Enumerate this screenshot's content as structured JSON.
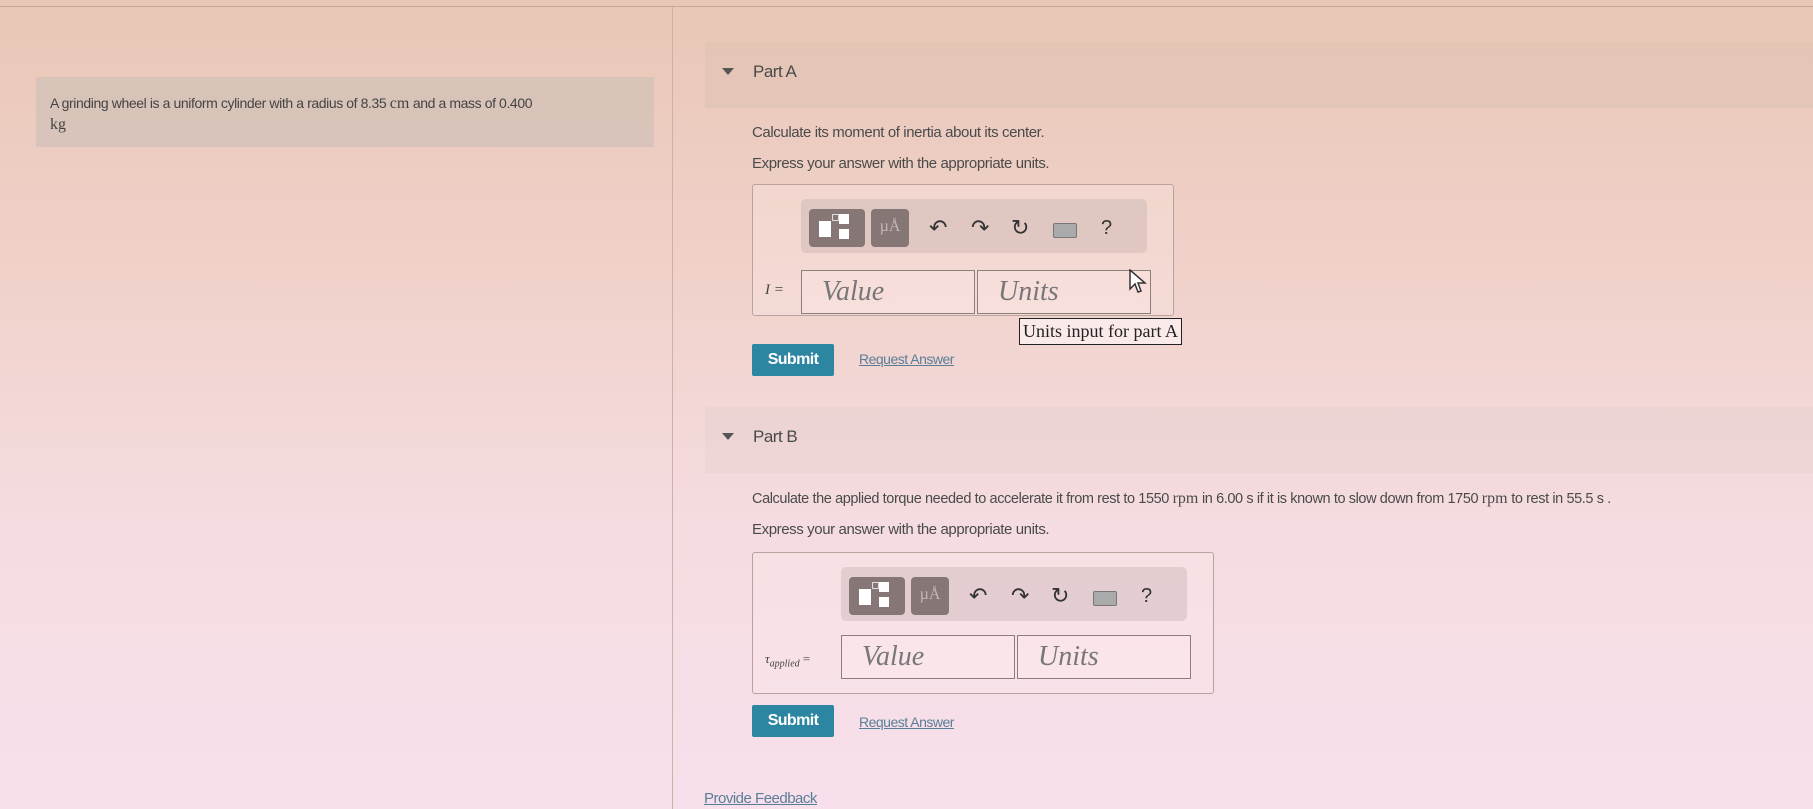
{
  "problem": {
    "intro_text": "A grinding wheel is a uniform cylinder with a radius of 8.35 ",
    "radius_unit": "cm",
    "intro_mid": " and a mass of 0.400",
    "mass_unit": "kg"
  },
  "parts": [
    {
      "title": "Part A",
      "question": "Calculate its moment of inertia about its center.",
      "instruction": "Express your answer with the appropriate units.",
      "variable_label": "I =",
      "value_placeholder": "Value",
      "units_placeholder": "Units",
      "tooltip": "Units input for part A",
      "submit_label": "Submit",
      "request_answer_label": "Request Answer"
    },
    {
      "title": "Part B",
      "question_1": "Calculate the applied torque needed to accelerate it from rest to 1550 ",
      "unit_1": "rpm",
      "question_2": " in 6.00 s if it is known to slow down from 1750 ",
      "unit_2": "rpm",
      "question_3": " to rest in 55.5 s .",
      "instruction": "Express your answer with the appropriate units.",
      "variable_symbol": "τ",
      "variable_subscript": "applied",
      "variable_eq": " =",
      "value_placeholder": "Value",
      "units_placeholder": "Units",
      "submit_label": "Submit",
      "request_answer_label": "Request Answer"
    }
  ],
  "toolbar": {
    "templates_icon": "templates-icon",
    "units_label": "µÅ",
    "undo_icon": "↶",
    "redo_icon": "↷",
    "reset_icon": "↻",
    "keyboard_icon": "keyboard-icon",
    "help_label": "?"
  },
  "footer": {
    "feedback_label": "Provide Feedback"
  }
}
